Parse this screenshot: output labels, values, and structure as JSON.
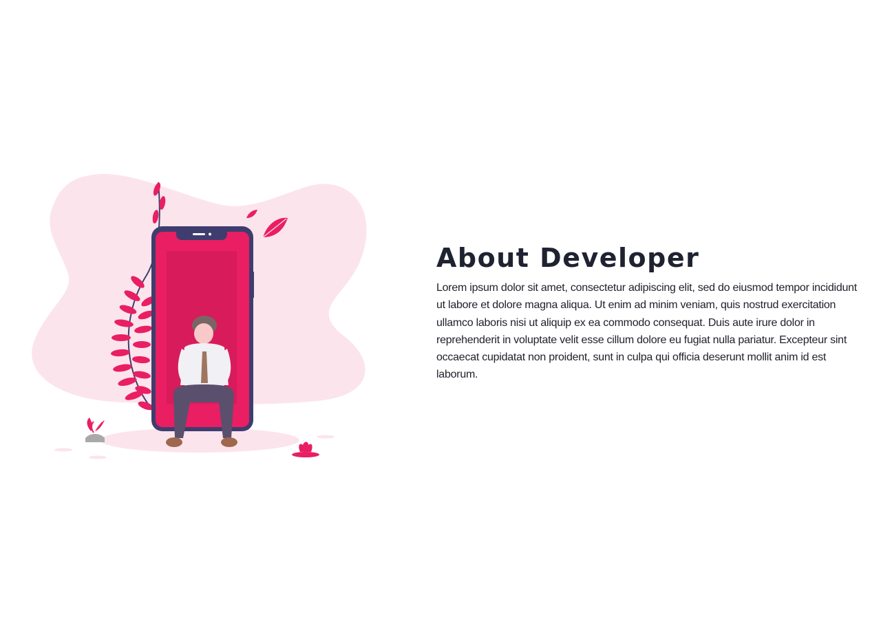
{
  "about": {
    "heading": "About Developer",
    "body": "Lorem ipsum dolor sit amet, consectetur adipiscing elit, sed do eiusmod tempor incididunt ut labore et dolore magna aliqua. Ut enim ad minim veniam, quis nostrud exercitation ullamco laboris nisi ut aliquip ex ea commodo consequat. Duis aute irure dolor in reprehenderit in voluptate velit esse cillum dolore eu fugiat nulla pariatur. Excepteur sint occaecat cupidatat non proident, sunt in culpa qui officia deserunt mollit anim id est laborum."
  },
  "illustration": {
    "icon": "developer-sitting-on-phone-illustration",
    "colors": {
      "blob": "#fce4ec",
      "accent": "#e91e63",
      "screen_dark": "#d81b5a",
      "phone_frame": "#3f3d6e",
      "shirt": "#f0f0f5",
      "pants": "#5b4f6e",
      "hair": "#7a6565",
      "skin": "#f9c8c8",
      "shoes": "#a0674f",
      "tie": "#a0755f",
      "stone": "#a9a9a9"
    }
  }
}
